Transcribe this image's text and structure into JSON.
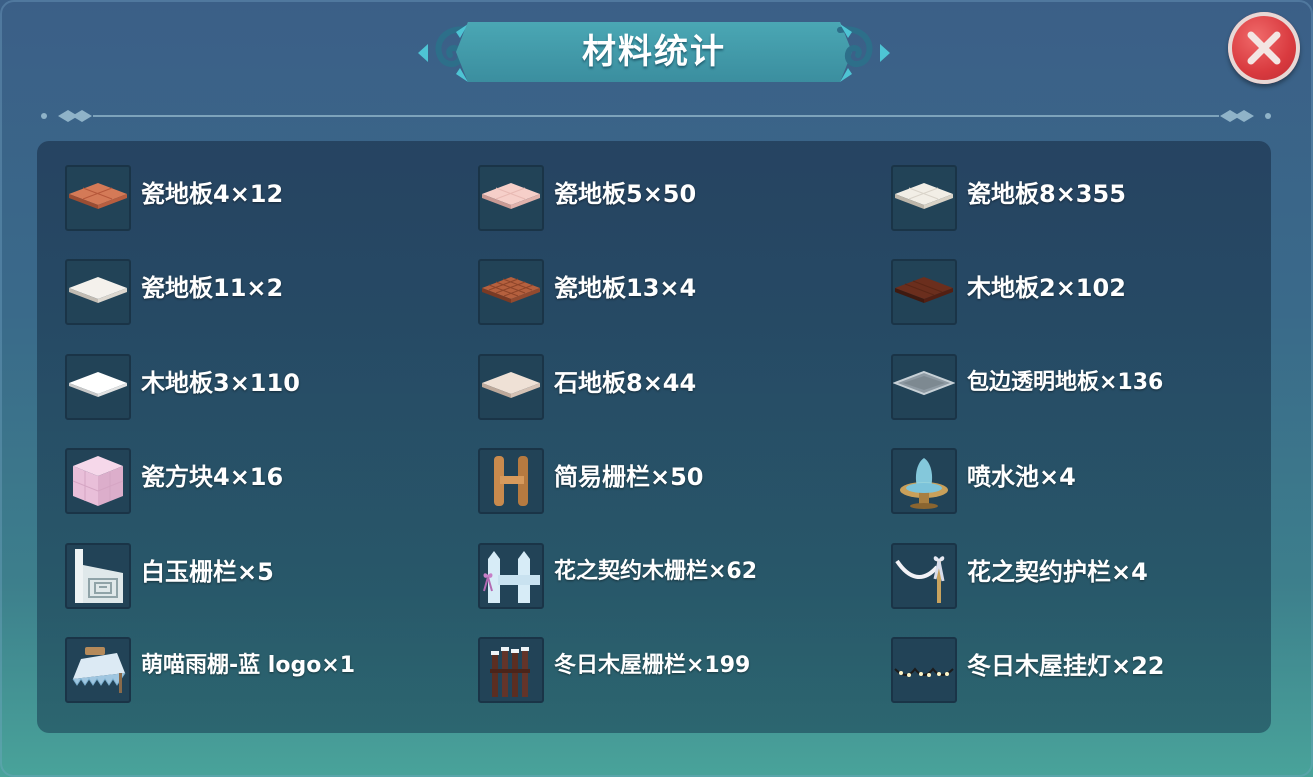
{
  "title": "材料统计",
  "colors": {
    "accent": "#4aa7b4",
    "close": "#d93a3f",
    "panel": "#1e3752"
  },
  "items": [
    {
      "label": "瓷地板4×12",
      "icon": "tile-floor-orange-icon"
    },
    {
      "label": "瓷地板5×50",
      "icon": "tile-floor-pink-icon"
    },
    {
      "label": "瓷地板8×355",
      "icon": "tile-floor-white-icon"
    },
    {
      "label": "瓷地板11×2",
      "icon": "tile-floor-white-icon"
    },
    {
      "label": "瓷地板13×4",
      "icon": "tile-floor-brown-icon"
    },
    {
      "label": "木地板2×102",
      "icon": "wood-floor-dark-icon"
    },
    {
      "label": "木地板3×110",
      "icon": "wood-floor-white-icon"
    },
    {
      "label": "石地板8×44",
      "icon": "stone-floor-icon"
    },
    {
      "label": "包边透明地板×136",
      "icon": "transparent-floor-icon"
    },
    {
      "label": "瓷方块4×16",
      "icon": "pink-cube-icon"
    },
    {
      "label": "简易栅栏×50",
      "icon": "simple-fence-icon"
    },
    {
      "label": "喷水池×4",
      "icon": "fountain-icon"
    },
    {
      "label": "白玉栅栏×5",
      "icon": "white-jade-fence-icon"
    },
    {
      "label": "花之契约木栅栏×62",
      "icon": "flower-wood-fence-icon"
    },
    {
      "label": "花之契约护栏×4",
      "icon": "flower-railing-icon"
    },
    {
      "label": "萌喵雨棚-蓝 logo×1",
      "icon": "awning-icon"
    },
    {
      "label": "冬日木屋栅栏×199",
      "icon": "winter-cabin-fence-icon"
    },
    {
      "label": "冬日木屋挂灯×22",
      "icon": "string-lights-icon"
    }
  ]
}
